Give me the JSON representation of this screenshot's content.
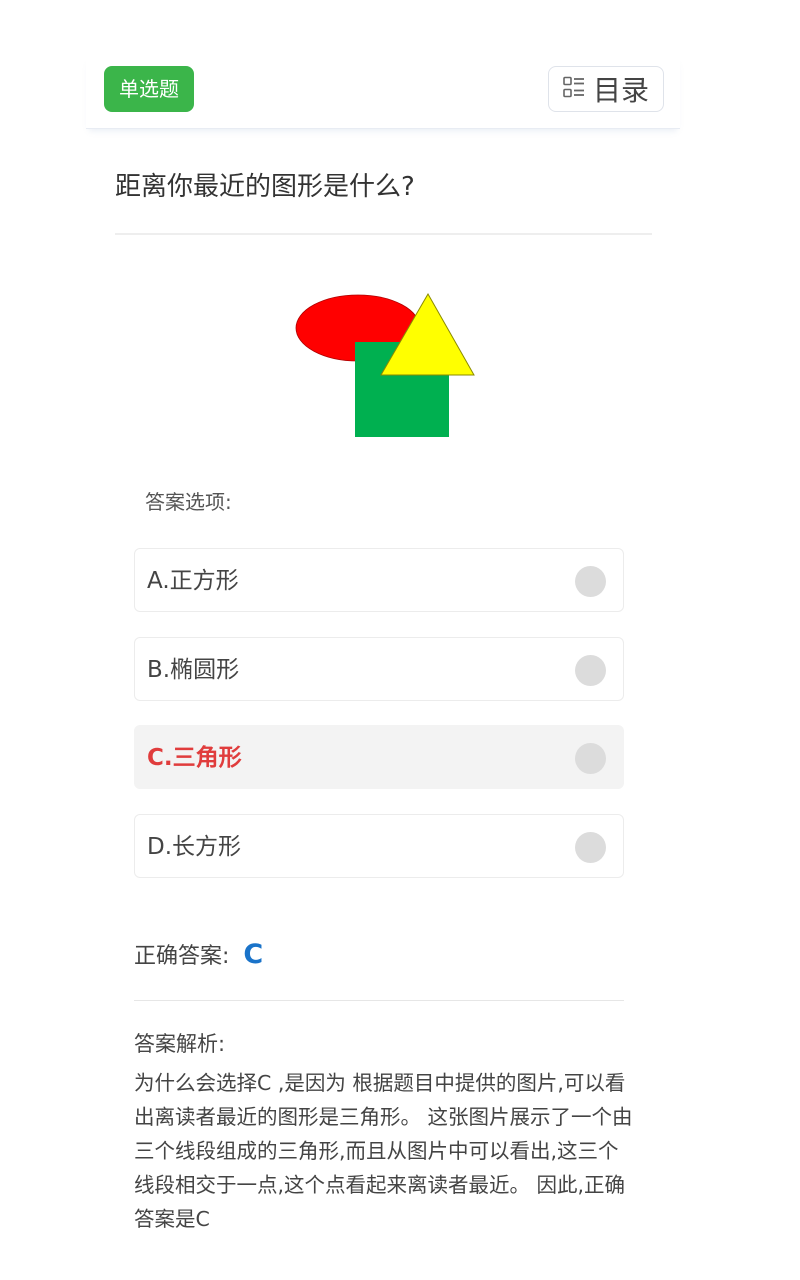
{
  "header": {
    "type_tag": "单选题",
    "toc_label": "目录",
    "toc_icon": "list-icon"
  },
  "question": {
    "text": "距离你最近的图形是什么?"
  },
  "figure": {
    "shapes": [
      {
        "name": "ellipse",
        "color": "#ff0000"
      },
      {
        "name": "square",
        "color": "#00b050"
      },
      {
        "name": "triangle",
        "color": "#ffff00"
      }
    ]
  },
  "options_title": "答案选项:",
  "options": [
    {
      "text": "A.正方形",
      "selected": false
    },
    {
      "text": "B.椭圆形",
      "selected": false
    },
    {
      "text": "C.三角形",
      "selected": true
    },
    {
      "text": "D.长方形",
      "selected": false
    }
  ],
  "answer": {
    "label": "正确答案:",
    "value": "C"
  },
  "analysis": {
    "title": "答案解析:",
    "text": "为什么会选择C ,是因为 根据题目中提供的图片,可以看出离读者最近的图形是三角形。 这张图片展示了一个由三个线段组成的三角形,而且从图片中可以看出,这三个线段相交于一点,这个点看起来离读者最近。 因此,正确答案是C"
  },
  "colors": {
    "tag_green": "#3bb54a",
    "selected_red": "#e03c3c",
    "answer_blue": "#1a73c9"
  }
}
